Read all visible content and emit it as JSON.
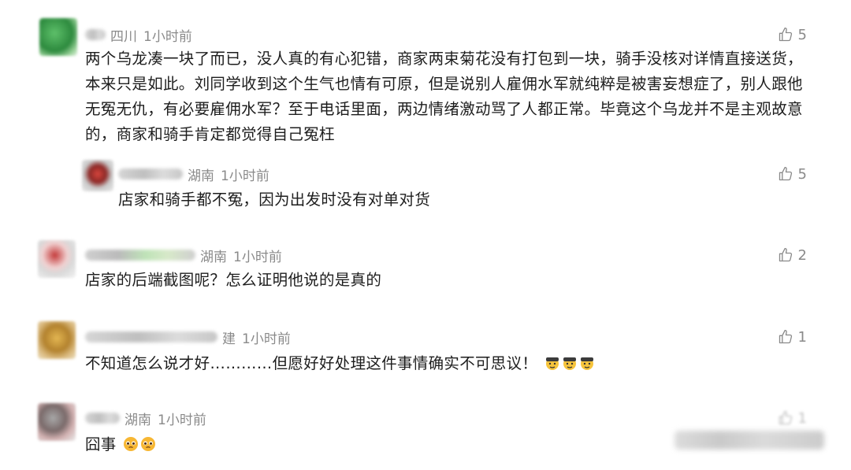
{
  "comments": [
    {
      "location": "四川",
      "time": "1小时前",
      "likes": "5",
      "text": "两个乌龙凑一块了而已，没人真的有心犯错，商家两束菊花没有打包到一块，骑手没核对详情直接送货，本来只是如此。刘同学收到这个生气也情有可原，但是说别人雇佣水军就纯粹是被害妄想症了，别人跟他无冤无仇，有必要雇佣水军？至于电话里面，两边情绪激动骂了人都正常。毕竟这个乌龙并不是主观故意的，商家和骑手肯定都觉得自己冤枉",
      "reply": {
        "location": "湖南",
        "time": "1小时前",
        "likes": "5",
        "text": "店家和骑手都不冤，因为出发时没有对单对货"
      }
    },
    {
      "location": "湖南",
      "time": "1小时前",
      "likes": "2",
      "text": "店家的后端截图呢？怎么证明他说的是真的"
    },
    {
      "location": "建",
      "time": "1小时前",
      "likes": "1",
      "text": "不知道怎么说才好…………但愿好好处理这件事情确实不可思议！"
    },
    {
      "location": "湖南",
      "time": "1小时前",
      "likes": "1",
      "text": "囧事"
    }
  ],
  "icons": {
    "like": "thumbs-up-icon",
    "emoji_salute": "salute-emoji-icon",
    "emoji_pleading": "pleading-emoji-icon"
  },
  "colors": {
    "meta_text": "#8a8a8a",
    "body_text": "#1d1d1d"
  }
}
